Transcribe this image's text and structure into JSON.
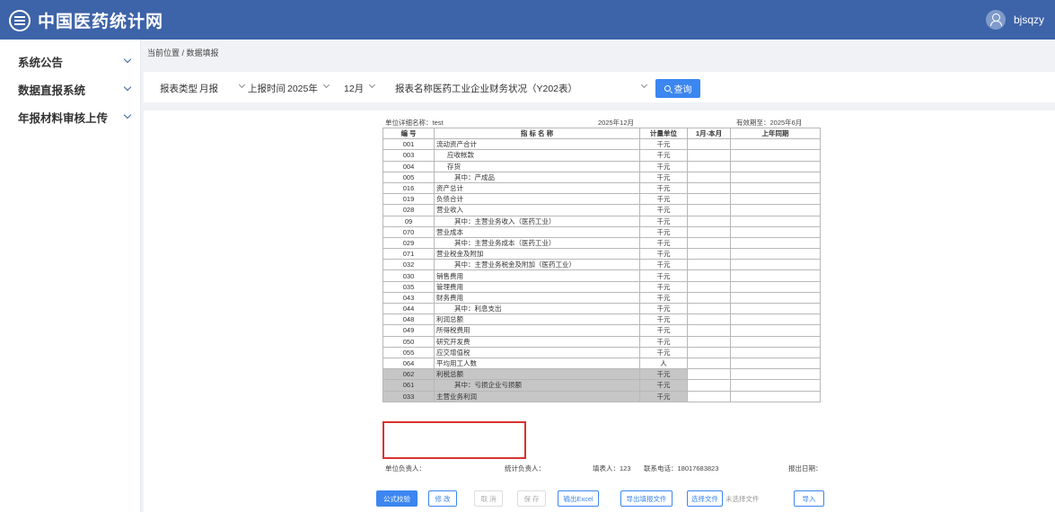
{
  "app": {
    "title": "中国医药统计网",
    "username": "bjsqzy"
  },
  "sidebar": {
    "items": [
      {
        "label": "系统公告"
      },
      {
        "label": "数据直报系统"
      },
      {
        "label": "年报材料审核上传"
      }
    ]
  },
  "breadcrumb": "当前位置 / 数据填报",
  "filters": {
    "report_type_label": "报表类型",
    "report_type_value": "月报",
    "period_label": "上报时间",
    "year_value": "2025年",
    "month_value": "12月",
    "report_name_label": "报表名称",
    "report_name_value": "医药工业企业财务状况（Y202表）",
    "query_label": "查询"
  },
  "report": {
    "unit_name": "单位详细名称：test",
    "period": "2025年12月",
    "valid_until": "有效期至：2025年6月",
    "headers": [
      "编 号",
      "指 标 名 称",
      "计量单位",
      "1月-本月",
      "上年同期"
    ],
    "rows": [
      {
        "code": "001",
        "name": "流动资产合计",
        "unit": "千元",
        "indent": 0
      },
      {
        "code": "003",
        "name": "应收帐款",
        "unit": "千元",
        "indent": 1
      },
      {
        "code": "004",
        "name": "存货",
        "unit": "千元",
        "indent": 1
      },
      {
        "code": "005",
        "name": "其中：产成品",
        "unit": "千元",
        "indent": 2
      },
      {
        "code": "016",
        "name": "资产总计",
        "unit": "千元",
        "indent": 0
      },
      {
        "code": "019",
        "name": "负债合计",
        "unit": "千元",
        "indent": 0
      },
      {
        "code": "028",
        "name": "营业收入",
        "unit": "千元",
        "indent": 0
      },
      {
        "code": "09",
        "name": "其中：主营业务收入（医药工业）",
        "unit": "千元",
        "indent": 2
      },
      {
        "code": "070",
        "name": "营业成本",
        "unit": "千元",
        "indent": 0
      },
      {
        "code": "029",
        "name": "其中：主营业务成本（医药工业）",
        "unit": "千元",
        "indent": 2
      },
      {
        "code": "071",
        "name": "营业税金及附加",
        "unit": "千元",
        "indent": 0
      },
      {
        "code": "032",
        "name": "其中：主营业务税金及附加（医药工业）",
        "unit": "千元",
        "indent": 2
      },
      {
        "code": "030",
        "name": "销售费用",
        "unit": "千元",
        "indent": 0
      },
      {
        "code": "035",
        "name": "管理费用",
        "unit": "千元",
        "indent": 0
      },
      {
        "code": "043",
        "name": "财务费用",
        "unit": "千元",
        "indent": 0
      },
      {
        "code": "044",
        "name": "其中：利息支出",
        "unit": "千元",
        "indent": 2
      },
      {
        "code": "048",
        "name": "利润总额",
        "unit": "千元",
        "indent": 0
      },
      {
        "code": "049",
        "name": "所得税费用",
        "unit": "千元",
        "indent": 0
      },
      {
        "code": "050",
        "name": "研究开发费",
        "unit": "千元",
        "indent": 0
      },
      {
        "code": "055",
        "name": "应交增值税",
        "unit": "千元",
        "indent": 0
      },
      {
        "code": "064",
        "name": "平均用工人数",
        "unit": "人",
        "indent": 0
      },
      {
        "code": "062",
        "name": "利税总额",
        "unit": "千元",
        "indent": 0,
        "grey": true
      },
      {
        "code": "061",
        "name": "其中：亏损企业亏损额",
        "unit": "千元",
        "indent": 2,
        "grey": true
      },
      {
        "code": "033",
        "name": "主营业务利润",
        "unit": "千元",
        "indent": 0,
        "grey": true
      }
    ],
    "footer": {
      "unit_head": "单位负责人：",
      "stat_head": "统计负责人：",
      "filler": "填表人：123",
      "phone": "联系电话：18017683823",
      "date": "报出日期："
    }
  },
  "buttons": {
    "formula_check": "公式校验",
    "edit": "修 改",
    "cancel": "取 消",
    "save": "保 存",
    "export_excel": "输出Excel",
    "export_fill": "导出填报文件",
    "choose_file": "选择文件",
    "no_file": "未选择文件",
    "import": "导入"
  },
  "colors": {
    "header_bg": "#3d63a8",
    "primary": "#3b86f0",
    "highlight_border": "#d9332e"
  }
}
